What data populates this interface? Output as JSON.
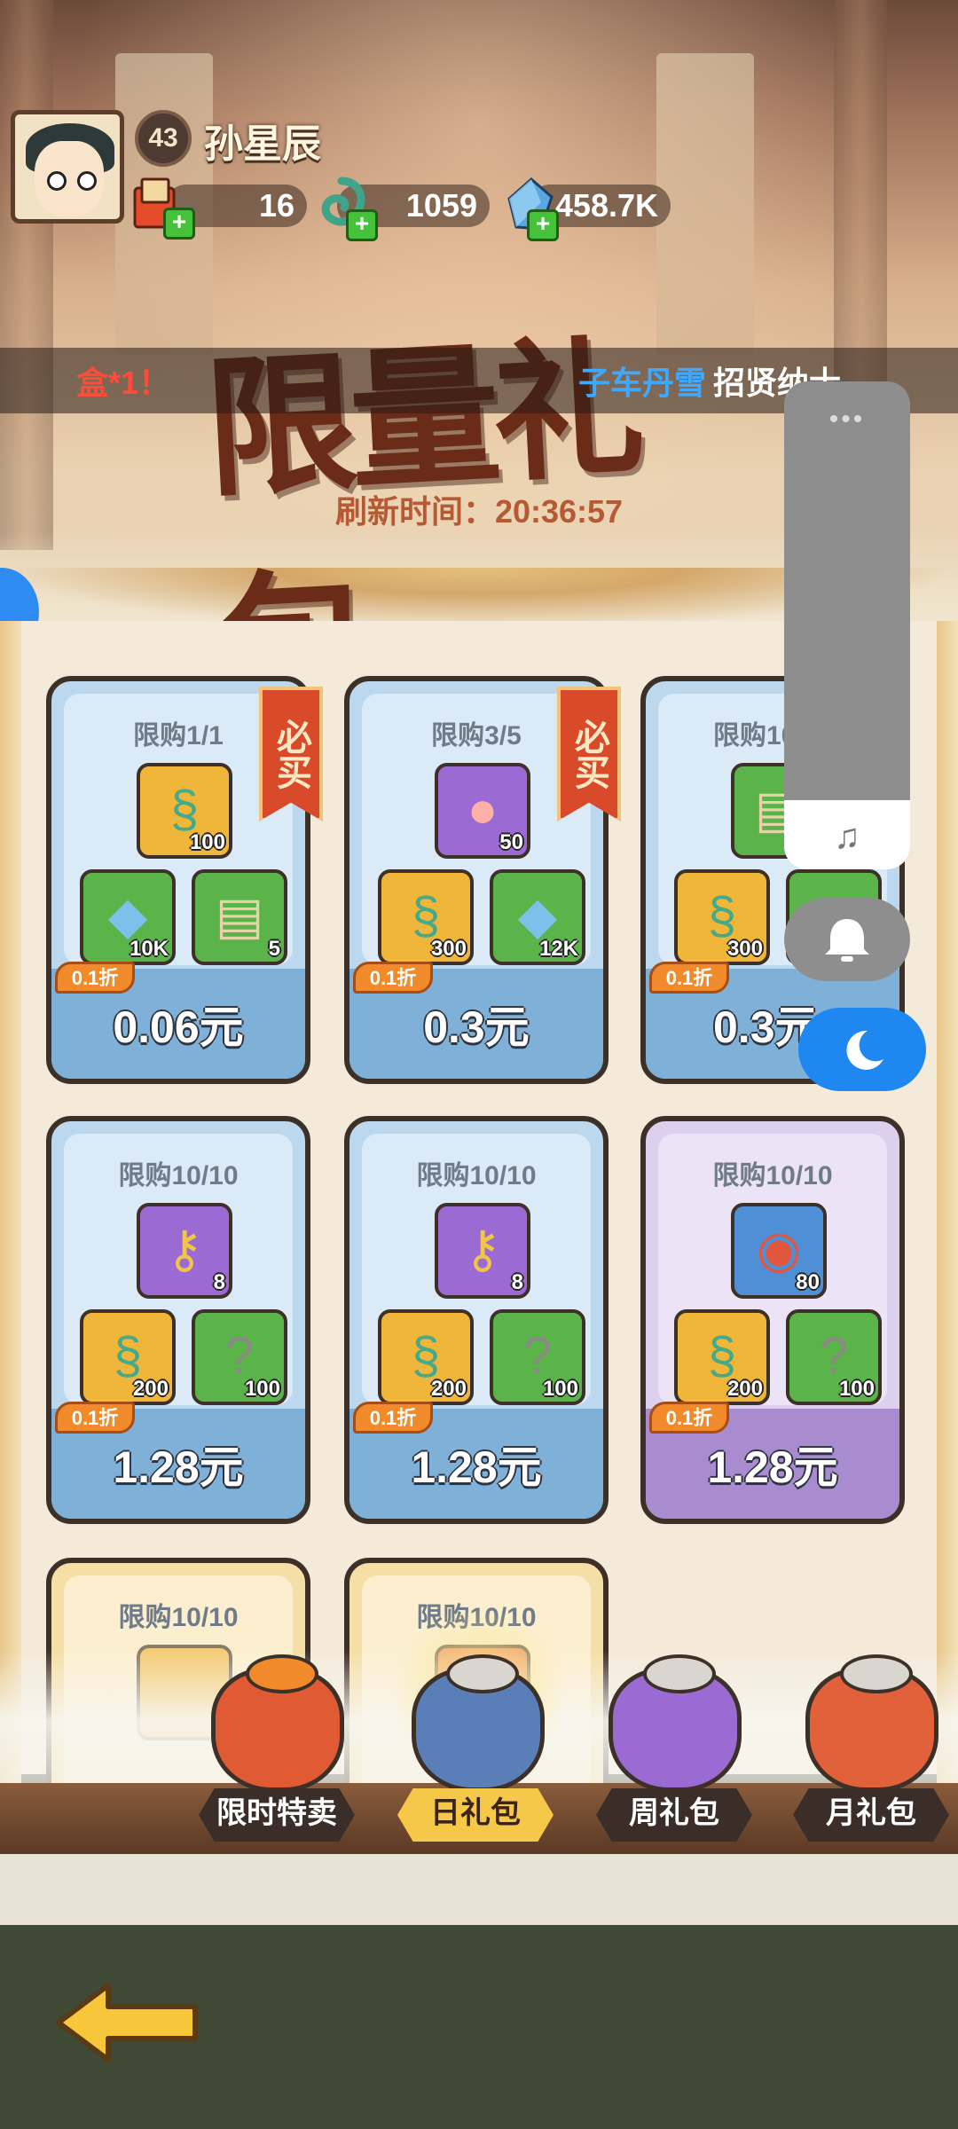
{
  "player": {
    "name": "孙星辰",
    "level": "43"
  },
  "resources": [
    {
      "name": "gift-token",
      "value": "16"
    },
    {
      "name": "jade",
      "value": "1059"
    },
    {
      "name": "crystal",
      "value": "458.7K"
    }
  ],
  "ticker": {
    "left_text": "盒*1！",
    "highlight": "子车丹雪",
    "message": "招贤纳士"
  },
  "banner": {
    "title": "限量礼包",
    "refresh_label": "刷新时间：20:36:57"
  },
  "cards": [
    {
      "limit": "限购1/1",
      "must_buy": "必买",
      "discount": "0.1折",
      "price": "0.06元",
      "items": [
        {
          "icon": "jade-icon",
          "qty": "100"
        },
        {
          "icon": "crystal-icon",
          "qty": "10K"
        },
        {
          "icon": "scroll-icon",
          "qty": "5"
        }
      ]
    },
    {
      "limit": "限购3/5",
      "must_buy": "必买",
      "discount": "0.1折",
      "price": "0.3元",
      "items": [
        {
          "icon": "peach-icon",
          "qty": "50"
        },
        {
          "icon": "jade-icon",
          "qty": "300"
        },
        {
          "icon": "crystal-icon",
          "qty": "12K"
        }
      ]
    },
    {
      "limit": "限购10",
      "discount": "0.1折",
      "price": "0.3元",
      "items": [
        {
          "icon": "scroll-icon",
          "qty": ""
        },
        {
          "icon": "jade-icon",
          "qty": "300"
        },
        {
          "icon": "crystal-icon",
          "qty": ""
        }
      ]
    },
    {
      "limit": "限购10/10",
      "discount": "0.1折",
      "price": "1.28元",
      "items": [
        {
          "icon": "key-icon",
          "qty": "8"
        },
        {
          "icon": "jade-icon",
          "qty": "200"
        },
        {
          "icon": "mystery-scroll-icon",
          "qty": "100"
        }
      ]
    },
    {
      "limit": "限购10/10",
      "discount": "0.1折",
      "price": "1.28元",
      "items": [
        {
          "icon": "key-icon",
          "qty": "8"
        },
        {
          "icon": "jade-icon",
          "qty": "200"
        },
        {
          "icon": "mystery-scroll-icon",
          "qty": "100"
        }
      ]
    },
    {
      "limit": "限购10/10",
      "discount": "0.1折",
      "price": "1.28元",
      "items": [
        {
          "icon": "meat-icon",
          "qty": "80"
        },
        {
          "icon": "jade-icon",
          "qty": "200"
        },
        {
          "icon": "mystery-scroll-icon",
          "qty": "100"
        }
      ]
    },
    {
      "limit": "限购10/10"
    },
    {
      "limit": "限购10/10"
    }
  ],
  "tabs": [
    {
      "label": "限时特卖"
    },
    {
      "label": "日礼包"
    },
    {
      "label": "周礼包"
    },
    {
      "label": "月礼包"
    }
  ],
  "overlay": {
    "more": "•••",
    "music_icon": "♫"
  },
  "colors": {
    "accent": "#f6c84a",
    "card_blue": "#bcd8ee",
    "card_purple": "#ddd0ee",
    "overlay_blue": "#1e87f0"
  }
}
